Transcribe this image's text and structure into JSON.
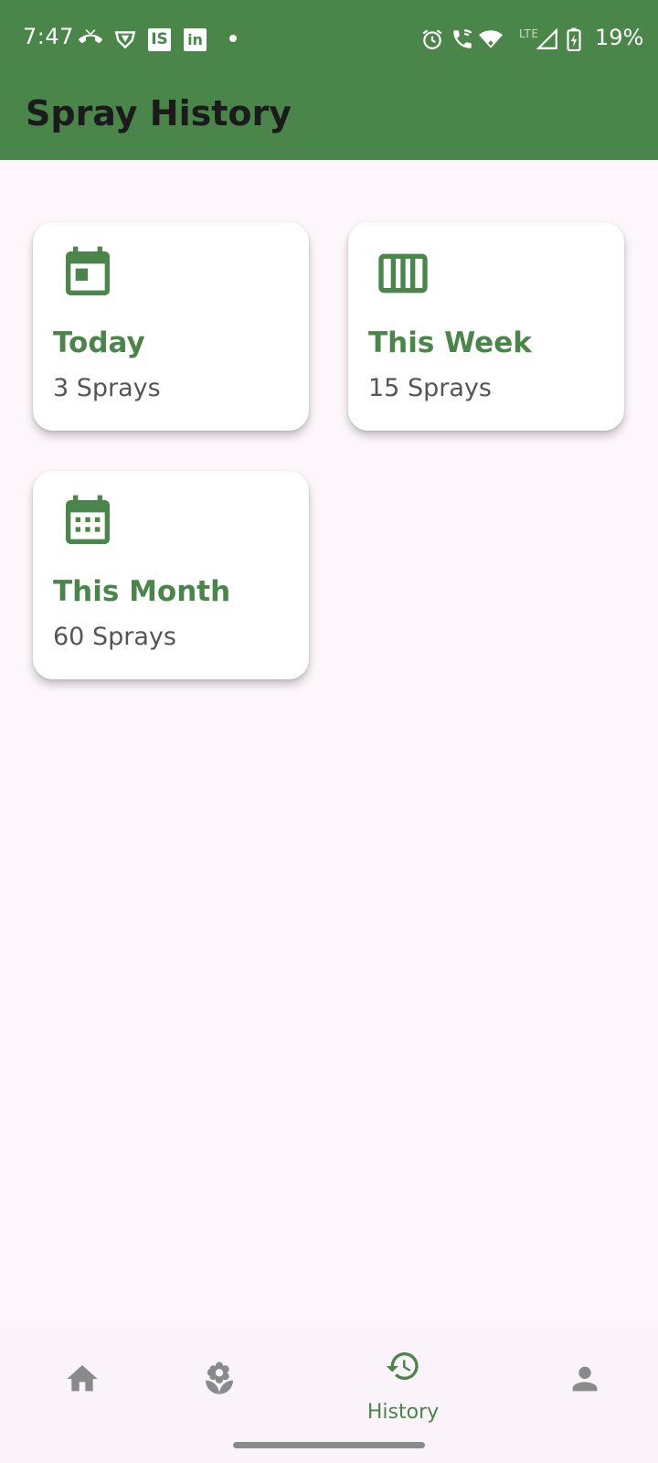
{
  "status_bar": {
    "time": "7:47",
    "battery": "19%",
    "network": "LTE",
    "left_icons": [
      "missed-call-icon",
      "vpn-shield-icon",
      "is-app-icon",
      "linkedin-icon",
      "notification-dot"
    ],
    "right_icons": [
      "alarm-icon",
      "wifi-calling-icon",
      "wifi-icon",
      "signal-icon",
      "battery-charging-icon"
    ],
    "is_label": "IS",
    "linkedin_label": "in"
  },
  "app_bar": {
    "title": "Spray History"
  },
  "cards": [
    {
      "icon": "calendar-today-icon",
      "title": "Today",
      "subtitle": "3 Sprays"
    },
    {
      "icon": "view-week-icon",
      "title": "This Week",
      "subtitle": "15 Sprays"
    },
    {
      "icon": "calendar-month-icon",
      "title": "This Month",
      "subtitle": "60 Sprays"
    }
  ],
  "bottom_nav": {
    "items": [
      {
        "icon": "home-icon",
        "label": "",
        "selected": false
      },
      {
        "icon": "flower-icon",
        "label": "",
        "selected": false
      },
      {
        "icon": "history-icon",
        "label": "History",
        "selected": true
      },
      {
        "icon": "person-icon",
        "label": "",
        "selected": false
      }
    ]
  },
  "colors": {
    "primary": "#4A854A",
    "background": "#FDF7FC",
    "title_text": "#1B1B1B",
    "inactive_nav": "#8A8A8A"
  }
}
